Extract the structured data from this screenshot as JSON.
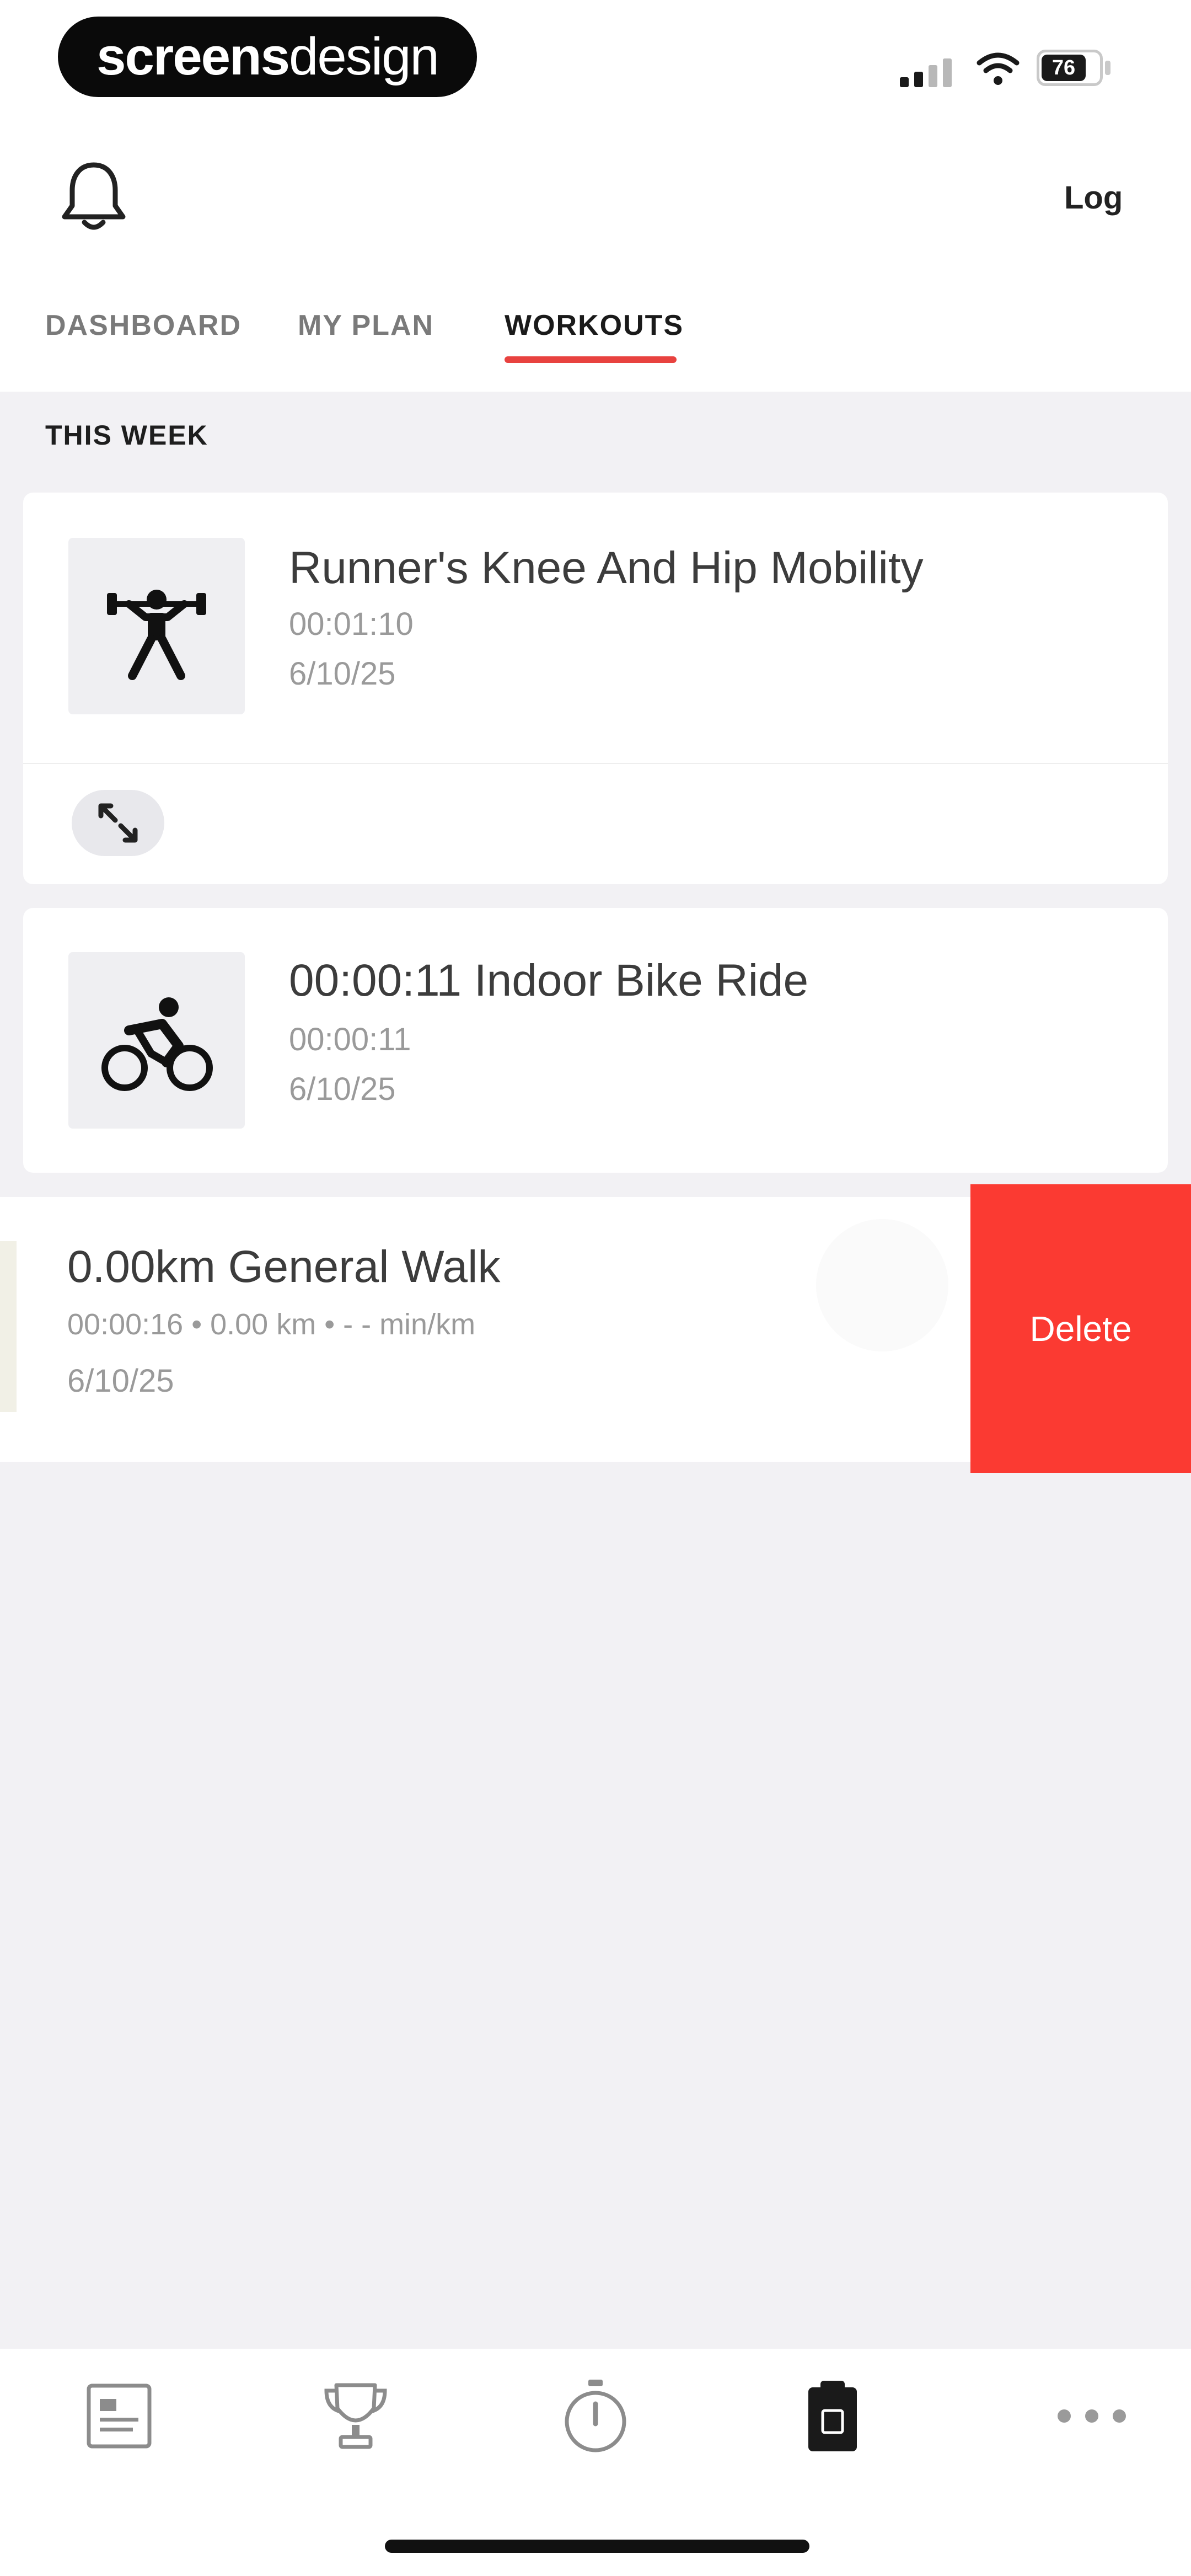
{
  "status_bar": {
    "brand": {
      "primary": "screens",
      "secondary": "design"
    },
    "battery": "76"
  },
  "header": {
    "bell_icon": "bell-icon",
    "right_action": "Log"
  },
  "tabs": [
    {
      "label": "DASHBOARD",
      "active": false
    },
    {
      "label": "MY PLAN",
      "active": false
    },
    {
      "label": "WORKOUTS",
      "active": true
    }
  ],
  "section": {
    "title": "THIS WEEK"
  },
  "workouts": [
    {
      "title": "Runner's Knee And Hip Mobility",
      "duration": "00:01:10",
      "date": "6/10/25",
      "icon": "weightlifter-icon"
    },
    {
      "title": "00:00:11 Indoor Bike Ride",
      "duration": "00:00:11",
      "date": "6/10/25",
      "icon": "cyclist-icon"
    },
    {
      "title": "0.00km General Walk",
      "stats": "00:00:16 • 0.00 km • - - min/km",
      "date": "6/10/25"
    }
  ],
  "delete_action": {
    "label": "Delete"
  },
  "bottom_nav": [
    {
      "icon": "journal-icon"
    },
    {
      "icon": "trophy-icon"
    },
    {
      "icon": "stopwatch-icon"
    },
    {
      "icon": "clipboard-icon",
      "active": true
    },
    {
      "icon": "more-icon"
    }
  ],
  "colors": {
    "accent": "#E8423F",
    "delete": "#FB3A32",
    "background": "#F2F1F4"
  }
}
